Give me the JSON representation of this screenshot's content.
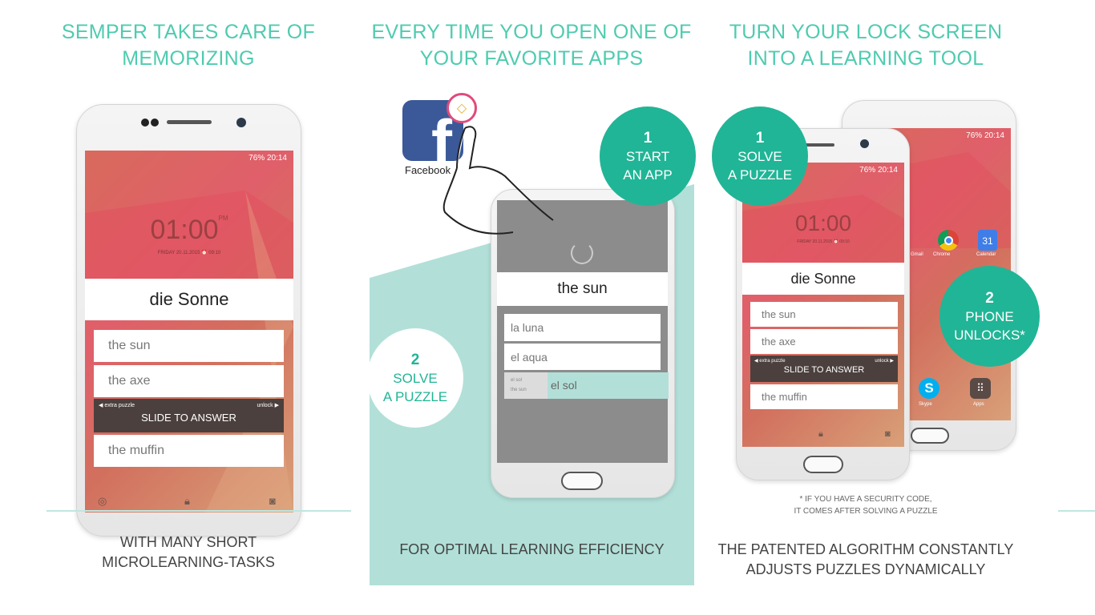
{
  "colors": {
    "accent": "#4fcbb0",
    "circle": "#20b596",
    "panel": "#b2e0d9",
    "slide_bar": "#4b403d"
  },
  "panel1": {
    "title": [
      "SEMPER TAKES CARE OF",
      "MEMORIZING"
    ],
    "status": "76% 20:14",
    "clock": "01:00",
    "ampm": "PM",
    "date": "FRIDAY 20.11.2015 ⏰ 09:10",
    "word": "die Sonne",
    "options": [
      "the sun",
      "the axe",
      "the muffin"
    ],
    "slide": {
      "left": "extra puzzle",
      "right": "unlock",
      "label": "SLIDE TO ANSWER"
    },
    "caption": [
      "WITH MANY SHORT",
      "MICROLEARNING-TASKS"
    ]
  },
  "panel2": {
    "title": [
      "EVERY TIME YOU OPEN ONE OF",
      "YOUR FAVORITE APPS"
    ],
    "app_label": "Facebook",
    "step1": {
      "num": "1",
      "lines": [
        "START",
        "AN APP"
      ]
    },
    "step2": {
      "num": "2",
      "lines": [
        "SOLVE",
        "A PUZZLE"
      ]
    },
    "word": "the sun",
    "options": [
      "la luna",
      "el aqua"
    ],
    "answer": {
      "hint_top": "el sol",
      "hint_bottom": "the sun",
      "label": "el sol"
    },
    "caption": "FOR OPTIMAL LEARNING EFFICIENCY"
  },
  "panel3": {
    "title": [
      "TURN YOUR LOCK SCREEN",
      "INTO A LEARNING TOOL"
    ],
    "step1": {
      "num": "1",
      "lines": [
        "SOLVE",
        "A PUZZLE"
      ]
    },
    "step2": {
      "num": "2",
      "lines": [
        "PHONE",
        "UNLOCKS*"
      ]
    },
    "status": "76% 20:14",
    "clock": "01:00",
    "date": "FRIDAY 20.11.2015 ⏰ 09:10",
    "word": "die Sonne",
    "options": [
      "the sun",
      "the axe",
      "the muffin"
    ],
    "slide": {
      "left": "extra puzzle",
      "right": "unlock",
      "label": "SLIDE TO ANSWER"
    },
    "apps": [
      "Gmail",
      "Chrome",
      "Calendar",
      "Skype",
      "Apps"
    ],
    "calendar_day": "31",
    "footnote": [
      "* IF YOU HAVE A SECURITY CODE,",
      "IT COMES AFTER SOLVING A PUZZLE"
    ],
    "caption": [
      "THE PATENTED ALGORITHM CONSTANTLY",
      "ADJUSTS PUZZLES DYNAMICALLY"
    ]
  }
}
